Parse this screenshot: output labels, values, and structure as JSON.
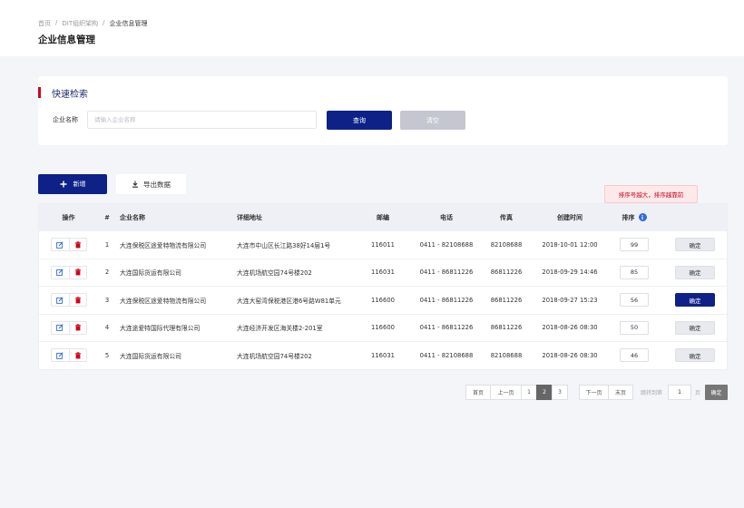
{
  "breadcrumb": [
    "首页",
    "DIT组织架构",
    "企业信息管理"
  ],
  "breadcrumb_separator": "/",
  "page_title": "企业信息管理",
  "search": {
    "section_title": "快速检索",
    "field_label": "企业名称",
    "placeholder": "请输入企业名称",
    "value": "",
    "query_label": "查询",
    "clear_label": "清空"
  },
  "toolbar": {
    "add_label": "新增",
    "export_label": "导出数据"
  },
  "tooltip": "排序号越大，排序越靠前",
  "table": {
    "headers": {
      "action": "操作",
      "num": "#",
      "name": "企业名称",
      "address": "详细地址",
      "zip": "邮编",
      "tel": "电话",
      "fax": "传真",
      "created": "创建时间",
      "sort": "排序"
    },
    "rows": [
      {
        "num": "1",
        "name": "大连保税区途爱特物流有限公司",
        "address": "大连市中山区长江路38好14层1号",
        "zip": "116011",
        "tel": "0411 - 82108688",
        "fax": "82108688",
        "created": "2018-10-01 12:00",
        "sort": "99",
        "ok": "确定",
        "ok_active": false
      },
      {
        "num": "2",
        "name": "大连国际货运有限公司",
        "address": "大连机场航空园74号楼202",
        "zip": "116031",
        "tel": "0411 - 86811226",
        "fax": "86811226",
        "created": "2018-09-29 14:46",
        "sort": "85",
        "ok": "确定",
        "ok_active": false
      },
      {
        "num": "3",
        "name": "大连保税区途爱特物流有限公司",
        "address": "大连大窑湾保税港区港6号路W81单元",
        "zip": "116600",
        "tel": "0411 - 86811226",
        "fax": "86811226",
        "created": "2018-09-27 15:23",
        "sort": "56",
        "ok": "确定",
        "ok_active": true
      },
      {
        "num": "4",
        "name": "大连途爱特国际代理有限公司",
        "address": "大连经济开发区海关楼2-201室",
        "zip": "116600",
        "tel": "0411 - 86811226",
        "fax": "86811226",
        "created": "2018-08-26 08:30",
        "sort": "50",
        "ok": "确定",
        "ok_active": false
      },
      {
        "num": "5",
        "name": "大连国际货运有限公司",
        "address": "大连机场航空园74号楼202",
        "zip": "116031",
        "tel": "0411 - 82108688",
        "fax": "82108688",
        "created": "2018-08-26 08:30",
        "sort": "46",
        "ok": "确定",
        "ok_active": false
      }
    ]
  },
  "pagination": {
    "first": "首页",
    "prev": "上一页",
    "pages": [
      "1",
      "2",
      "3"
    ],
    "current_page": "2",
    "next": "下一页",
    "last": "末页",
    "jump_label": "跳转到第",
    "jump_value": "1",
    "page_unit": "页",
    "confirm": "确定"
  },
  "colors": {
    "primary": "#0d2187",
    "danger": "#d0021b",
    "info": "#2f6be0"
  }
}
